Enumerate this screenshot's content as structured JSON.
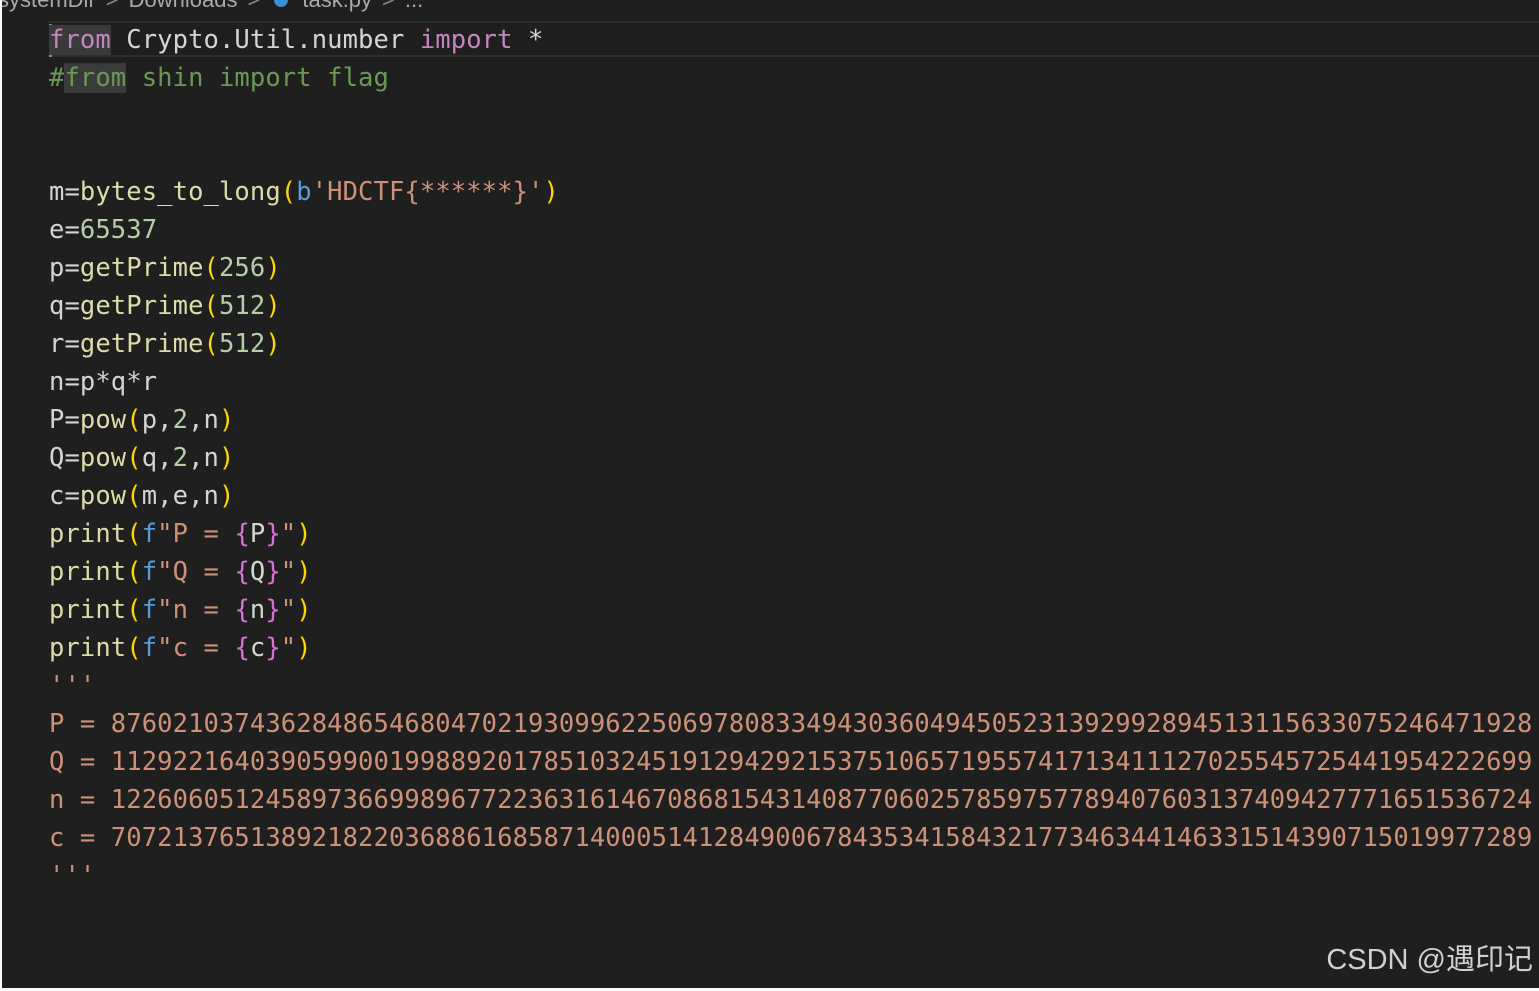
{
  "breadcrumb": {
    "segments": [
      "systemDir",
      "Downloads",
      "task.py",
      "..."
    ],
    "separator": ">"
  },
  "code": {
    "lines": [
      {
        "tokens": [
          {
            "text": "from",
            "cls": "kw hl-from"
          },
          {
            "text": " Crypto.Util.number ",
            "cls": ""
          },
          {
            "text": "import",
            "cls": "kw"
          },
          {
            "text": " *",
            "cls": ""
          }
        ]
      },
      {
        "tokens": [
          {
            "text": "#",
            "cls": "cm"
          },
          {
            "text": "from",
            "cls": "cm hl-from"
          },
          {
            "text": " shin import flag",
            "cls": "cm"
          }
        ]
      },
      {
        "tokens": []
      },
      {
        "tokens": []
      },
      {
        "tokens": [
          {
            "text": "m=",
            "cls": ""
          },
          {
            "text": "bytes_to_long",
            "cls": "fn"
          },
          {
            "text": "(",
            "cls": "p1"
          },
          {
            "text": "b",
            "cls": "bl"
          },
          {
            "text": "'HDCTF{******}'",
            "cls": "str"
          },
          {
            "text": ")",
            "cls": "p1"
          }
        ]
      },
      {
        "tokens": [
          {
            "text": "e=",
            "cls": ""
          },
          {
            "text": "65537",
            "cls": "num"
          }
        ]
      },
      {
        "tokens": [
          {
            "text": "p=",
            "cls": ""
          },
          {
            "text": "getPrime",
            "cls": "fn"
          },
          {
            "text": "(",
            "cls": "p1"
          },
          {
            "text": "256",
            "cls": "num"
          },
          {
            "text": ")",
            "cls": "p1"
          }
        ]
      },
      {
        "tokens": [
          {
            "text": "q=",
            "cls": ""
          },
          {
            "text": "getPrime",
            "cls": "fn"
          },
          {
            "text": "(",
            "cls": "p1"
          },
          {
            "text": "512",
            "cls": "num"
          },
          {
            "text": ")",
            "cls": "p1"
          }
        ]
      },
      {
        "tokens": [
          {
            "text": "r=",
            "cls": ""
          },
          {
            "text": "getPrime",
            "cls": "fn"
          },
          {
            "text": "(",
            "cls": "p1"
          },
          {
            "text": "512",
            "cls": "num"
          },
          {
            "text": ")",
            "cls": "p1"
          }
        ]
      },
      {
        "tokens": [
          {
            "text": "n=p*q*r",
            "cls": ""
          }
        ]
      },
      {
        "tokens": [
          {
            "text": "P=",
            "cls": ""
          },
          {
            "text": "pow",
            "cls": "fn"
          },
          {
            "text": "(",
            "cls": "p1"
          },
          {
            "text": "p,",
            "cls": ""
          },
          {
            "text": "2",
            "cls": "num"
          },
          {
            "text": ",n",
            "cls": ""
          },
          {
            "text": ")",
            "cls": "p1"
          }
        ]
      },
      {
        "tokens": [
          {
            "text": "Q=",
            "cls": ""
          },
          {
            "text": "pow",
            "cls": "fn"
          },
          {
            "text": "(",
            "cls": "p1"
          },
          {
            "text": "q,",
            "cls": ""
          },
          {
            "text": "2",
            "cls": "num"
          },
          {
            "text": ",n",
            "cls": ""
          },
          {
            "text": ")",
            "cls": "p1"
          }
        ]
      },
      {
        "tokens": [
          {
            "text": "c=",
            "cls": ""
          },
          {
            "text": "pow",
            "cls": "fn"
          },
          {
            "text": "(",
            "cls": "p1"
          },
          {
            "text": "m,e,n",
            "cls": ""
          },
          {
            "text": ")",
            "cls": "p1"
          }
        ]
      },
      {
        "tokens": [
          {
            "text": "print",
            "cls": "fn"
          },
          {
            "text": "(",
            "cls": "p1"
          },
          {
            "text": "f",
            "cls": "bl"
          },
          {
            "text": "\"P = ",
            "cls": "str"
          },
          {
            "text": "{",
            "cls": "p2"
          },
          {
            "text": "P",
            "cls": ""
          },
          {
            "text": "}",
            "cls": "p2"
          },
          {
            "text": "\"",
            "cls": "str"
          },
          {
            "text": ")",
            "cls": "p1"
          }
        ]
      },
      {
        "tokens": [
          {
            "text": "print",
            "cls": "fn"
          },
          {
            "text": "(",
            "cls": "p1"
          },
          {
            "text": "f",
            "cls": "bl"
          },
          {
            "text": "\"Q = ",
            "cls": "str"
          },
          {
            "text": "{",
            "cls": "p2"
          },
          {
            "text": "Q",
            "cls": ""
          },
          {
            "text": "}",
            "cls": "p2"
          },
          {
            "text": "\"",
            "cls": "str"
          },
          {
            "text": ")",
            "cls": "p1"
          }
        ]
      },
      {
        "tokens": [
          {
            "text": "print",
            "cls": "fn"
          },
          {
            "text": "(",
            "cls": "p1"
          },
          {
            "text": "f",
            "cls": "bl"
          },
          {
            "text": "\"n = ",
            "cls": "str"
          },
          {
            "text": "{",
            "cls": "p2"
          },
          {
            "text": "n",
            "cls": ""
          },
          {
            "text": "}",
            "cls": "p2"
          },
          {
            "text": "\"",
            "cls": "str"
          },
          {
            "text": ")",
            "cls": "p1"
          }
        ]
      },
      {
        "tokens": [
          {
            "text": "print",
            "cls": "fn"
          },
          {
            "text": "(",
            "cls": "p1"
          },
          {
            "text": "f",
            "cls": "bl"
          },
          {
            "text": "\"c = ",
            "cls": "str"
          },
          {
            "text": "{",
            "cls": "p2"
          },
          {
            "text": "c",
            "cls": ""
          },
          {
            "text": "}",
            "cls": "p2"
          },
          {
            "text": "\"",
            "cls": "str"
          },
          {
            "text": ")",
            "cls": "p1"
          }
        ]
      },
      {
        "tokens": [
          {
            "text": "'''",
            "cls": "str"
          }
        ]
      },
      {
        "tokens": [
          {
            "text": "P = 87602103743628486546804702193099622506978083349430360494505231392992894513115633075246471928",
            "cls": "str"
          }
        ]
      },
      {
        "tokens": [
          {
            "text": "Q = 11292216403905990019988920178510324519129429215375106571955741713411127025545725441954222699",
            "cls": "str"
          }
        ]
      },
      {
        "tokens": [
          {
            "text": "n = 12260605124589736699896772236316146708681543140877060257859757789407603137409427771651536724",
            "cls": "str"
          }
        ]
      },
      {
        "tokens": [
          {
            "text": "c = 70721376513892182203688616858714000514128490067843534158432177346344146331514390715019977289",
            "cls": "str"
          }
        ]
      },
      {
        "tokens": [
          {
            "text": "'''",
            "cls": "str"
          }
        ]
      }
    ]
  },
  "watermark": "CSDN @遇印记",
  "colors": {
    "editor_bg": "#1f1f1f",
    "keyword": "#c586c0",
    "function": "#dcdcaa",
    "number": "#b5cea8",
    "string": "#ce9178",
    "comment": "#6a9955",
    "bracket_1": "#ffd700",
    "bracket_2": "#da70d6"
  }
}
